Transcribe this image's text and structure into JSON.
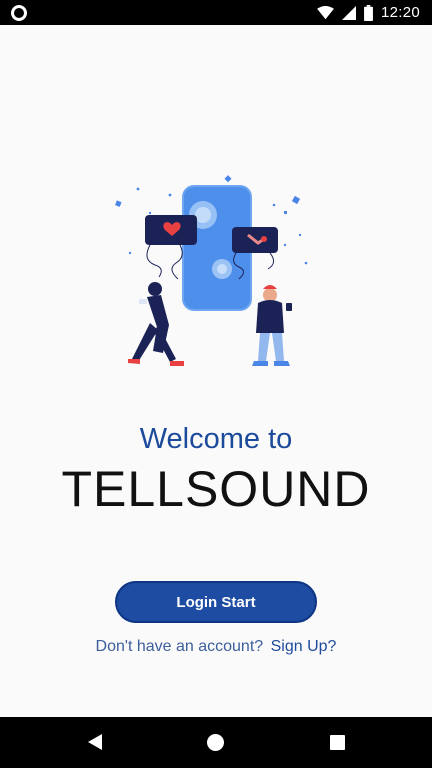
{
  "status_bar": {
    "time": "12:20",
    "icons": [
      "record-icon",
      "wifi-icon",
      "signal-icon",
      "battery-icon"
    ]
  },
  "main": {
    "illustration": "people-with-phone-illustration",
    "welcome": "Welcome to",
    "brand": "TELLSOUND",
    "login_label": "Login Start",
    "signup_prompt": "Don't have an account?",
    "signup_link": "Sign Up?"
  },
  "nav_bar": {
    "icons": [
      "back-icon",
      "home-icon",
      "recent-apps-icon"
    ]
  },
  "colors": {
    "accent": "#1d4ca2",
    "heading": "#1d4b9b",
    "background": "#fafafa"
  }
}
